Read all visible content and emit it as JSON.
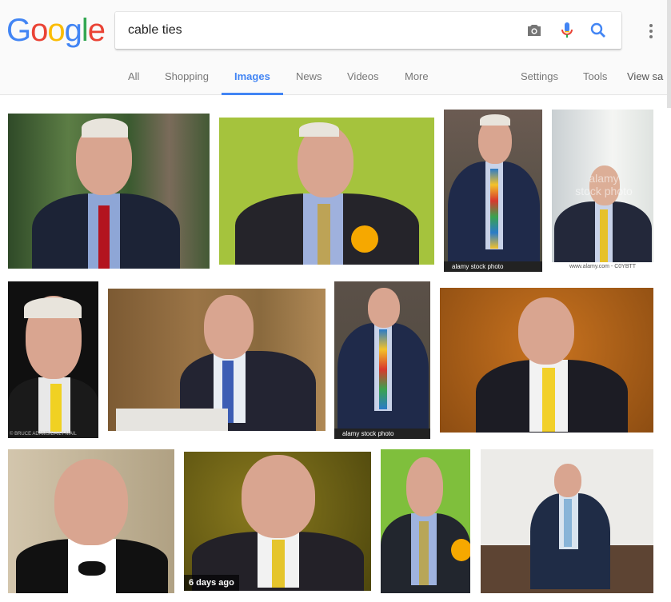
{
  "logo": [
    "G",
    "o",
    "o",
    "g",
    "l",
    "e"
  ],
  "logo_colors": [
    "#4285f4",
    "#ea4335",
    "#fbbc05",
    "#4285f4",
    "#34a853",
    "#ea4335"
  ],
  "search": {
    "query": "cable ties"
  },
  "tabs": [
    {
      "label": "All",
      "active": false
    },
    {
      "label": "Shopping",
      "active": false
    },
    {
      "label": "Images",
      "active": true
    },
    {
      "label": "News",
      "active": false
    },
    {
      "label": "Videos",
      "active": false
    },
    {
      "label": "More",
      "active": false
    }
  ],
  "tools": {
    "settings": "Settings",
    "tools": "Tools",
    "view_saved": "View sa"
  },
  "results": {
    "stamp_alamy": "alamy stock photo",
    "watermark": "alamy\nstock photo",
    "badge_days": "6 days ago",
    "credit_small": "www.alamy.com - C0YBTT",
    "credit_bruce": "© BRUCE ADAMS/DAILY MAIL"
  },
  "colors": {
    "accent": "#4285f4",
    "tab_inactive": "#777777"
  }
}
